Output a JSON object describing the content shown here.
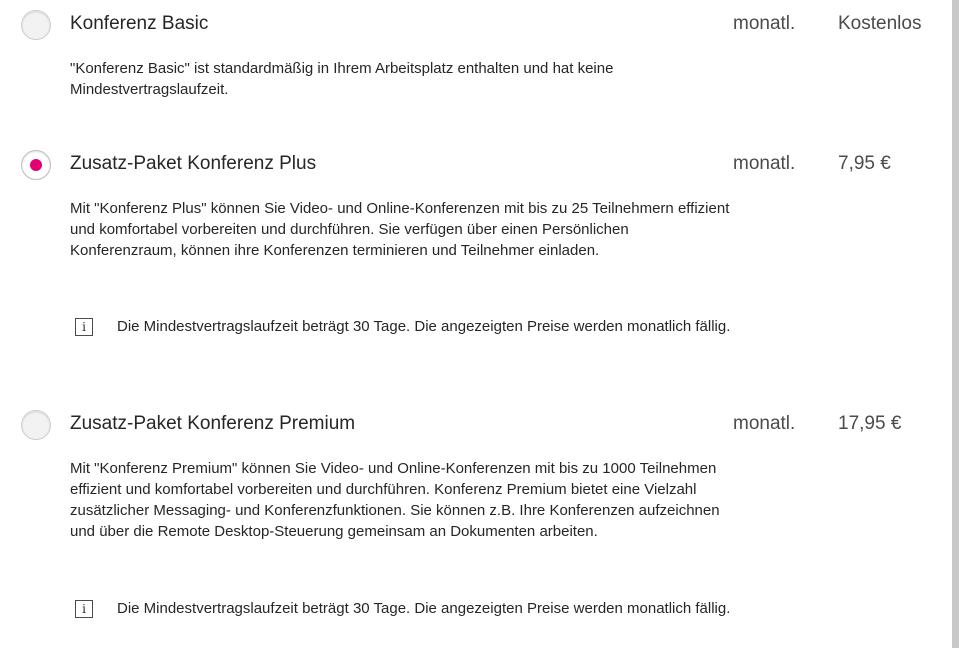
{
  "packages": [
    {
      "title": "Konferenz Basic",
      "period": "monatl.",
      "price": "Kostenlos",
      "selected": false,
      "description": "\"Konferenz Basic\" ist standardmäßig in Ihrem Arbeitsplatz enthalten und hat keine Mindestvertragslaufzeit."
    },
    {
      "title": "Zusatz-Paket Konferenz Plus",
      "period": "monatl.",
      "price": "7,95 €",
      "selected": true,
      "description": "Mit \"Konferenz Plus\" können Sie Video- und Online-Konferenzen mit bis zu 25 Teilnehmern effizient und komfortabel vorbereiten und durchführen. Sie verfügen über einen Persönlichen Konferenzraum, können ihre Konferenzen terminieren und Teilnehmer einladen.",
      "info_icon": "info-icon",
      "info": "Die Mindestvertragslaufzeit beträgt 30 Tage. Die angezeigten Preise werden monatlich fällig."
    },
    {
      "title": "Zusatz-Paket Konferenz Premium",
      "period": "monatl.",
      "price": "17,95 €",
      "selected": false,
      "description": "Mit \"Konferenz Premium\" können Sie Video- und Online-Konferenzen mit bis zu 1000 Teilnehmen effizient und komfortabel vorbereiten und durchführen. Konferenz Premium bietet eine Vielzahl zusätzlicher Messaging- und Konferenzfunktionen. Sie können z.B. Ihre Konferenzen aufzeichnen und über die Remote Desktop-Steuerung gemeinsam an Dokumenten arbeiten.",
      "info_icon": "info-icon",
      "info": "Die Mindestvertragslaufzeit beträgt 30 Tage. Die angezeigten Preise werden monatlich fällig."
    }
  ],
  "colors": {
    "accent": "#e20074",
    "text": "#262626",
    "muted": "#4b4b4b"
  }
}
